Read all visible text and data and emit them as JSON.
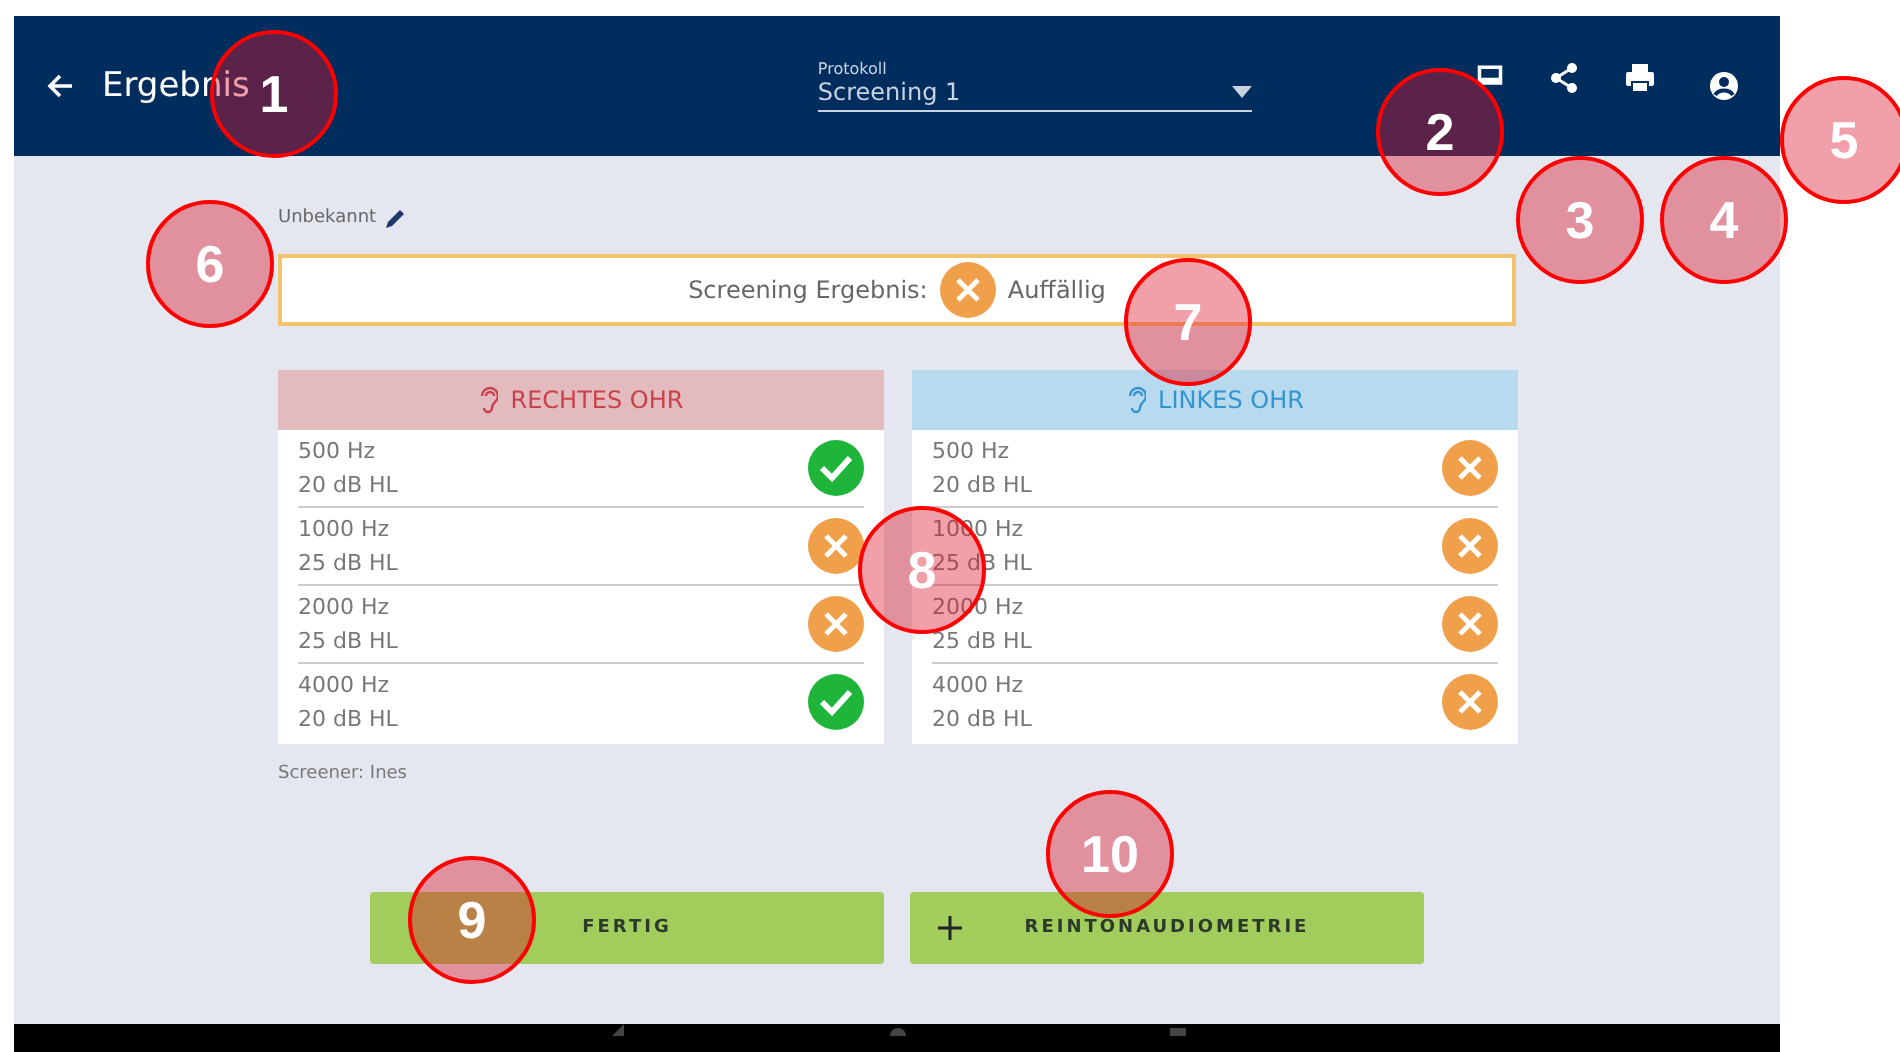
{
  "app_bar": {
    "title": "Ergebnis",
    "protocol": {
      "label": "Protokoll",
      "value": "Screening 1"
    }
  },
  "patient": "Unbekannt",
  "result": {
    "label": "Screening Ergebnis:",
    "passed": false,
    "value": "Auffällig"
  },
  "ears": [
    {
      "kind": "right",
      "title": "RECHTES OHR",
      "rows": [
        {
          "frequency": "500 Hz",
          "level_text": "20 dB HL",
          "passed": true
        },
        {
          "frequency": "1000 Hz",
          "level_text": "25 dB HL",
          "passed": false
        },
        {
          "frequency": "2000 Hz",
          "level_text": "25 dB HL",
          "passed": false
        },
        {
          "frequency": "4000 Hz",
          "level_text": "20 dB HL",
          "passed": true
        }
      ]
    },
    {
      "kind": "left",
      "title": "LINKES OHR",
      "rows": [
        {
          "frequency": "500 Hz",
          "level_text": "20 dB HL",
          "passed": false
        },
        {
          "frequency": "1000 Hz",
          "level_text": "25 dB HL",
          "passed": false
        },
        {
          "frequency": "2000 Hz",
          "level_text": "25 dB HL",
          "passed": false
        },
        {
          "frequency": "4000 Hz",
          "level_text": "20 dB HL",
          "passed": false
        }
      ]
    }
  ],
  "screener": "Screener: Ines",
  "buttons": [
    {
      "kind": "done",
      "label": "FERTIG"
    },
    {
      "kind": "add",
      "label": "REINTONAUDIOMETRIE"
    }
  ],
  "callouts": [
    "1",
    "2",
    "3",
    "4",
    "5",
    "6",
    "7",
    "8",
    "9",
    "10"
  ]
}
